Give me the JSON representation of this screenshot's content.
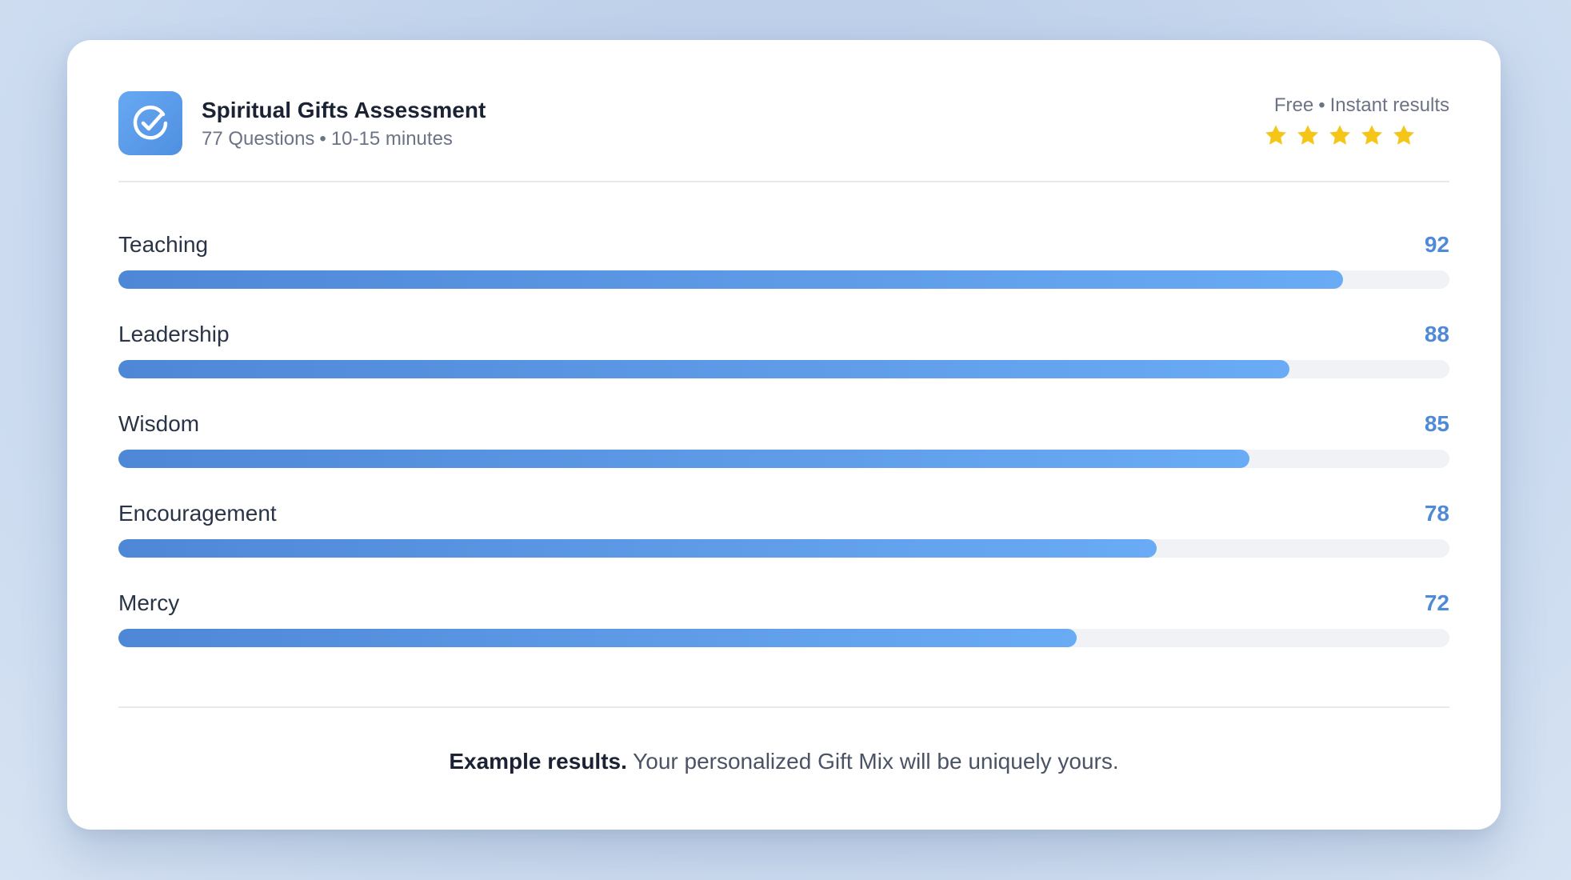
{
  "header": {
    "title": "Spiritual Gifts Assessment",
    "questions": "77 Questions",
    "separator": "•",
    "duration": "10-15 minutes",
    "price": "Free",
    "results_speed": "Instant results",
    "rating_stars": 5,
    "icon": "check-circle-icon",
    "icon_color": "#5b9bea",
    "star_color": "#f5c518"
  },
  "gifts": [
    {
      "label": "Teaching",
      "score": "92",
      "value": 92
    },
    {
      "label": "Leadership",
      "score": "88",
      "value": 88
    },
    {
      "label": "Wisdom",
      "score": "85",
      "value": 85
    },
    {
      "label": "Encouragement",
      "score": "78",
      "value": 78
    },
    {
      "label": "Mercy",
      "score": "72",
      "value": 72
    }
  ],
  "footer": {
    "emphasis": "Example results.",
    "text": " Your personalized Gift Mix will be uniquely yours."
  },
  "colors": {
    "accent": "#4f8ad8",
    "bar_start": "#4e87d6",
    "bar_end": "#6aabf5",
    "track": "#f1f2f5"
  }
}
